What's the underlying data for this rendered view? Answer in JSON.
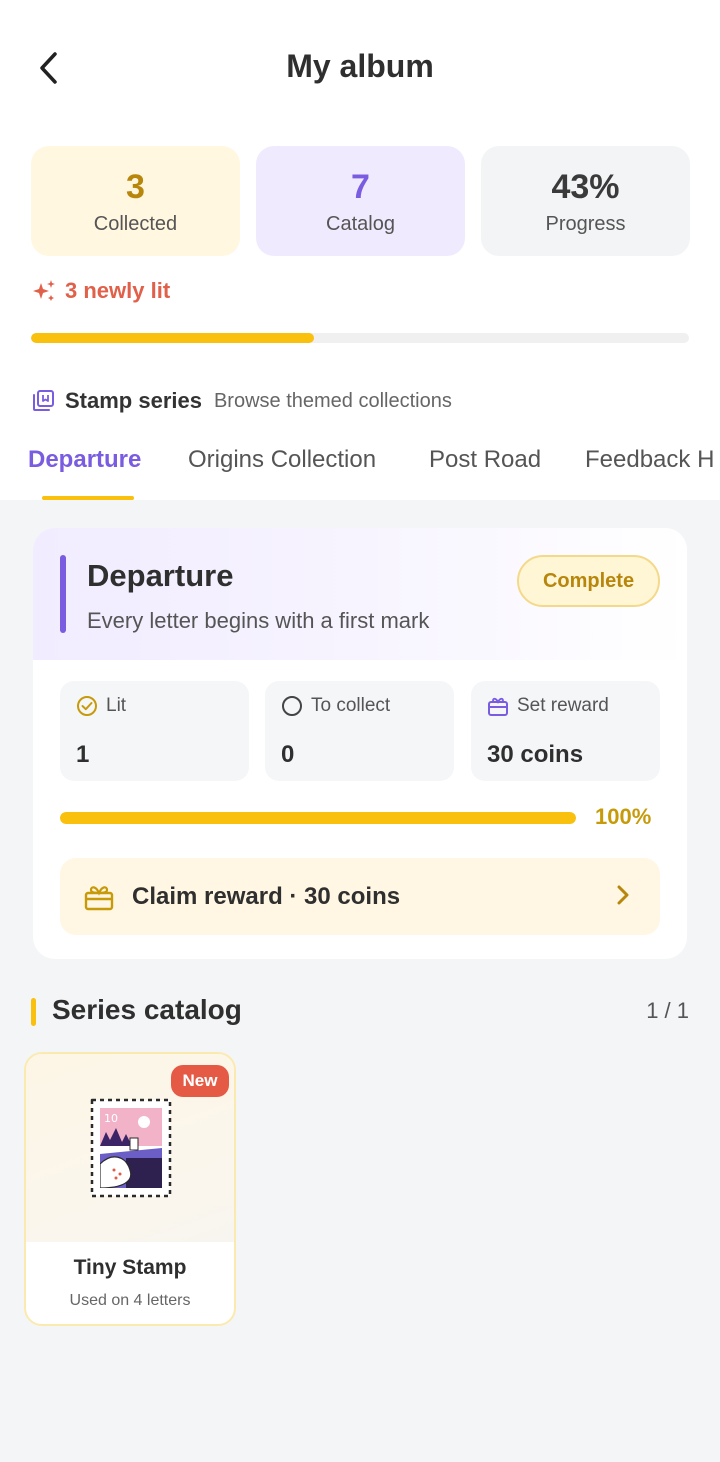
{
  "header": {
    "title": "My album"
  },
  "stats": {
    "collected": {
      "value": "3",
      "label": "Collected"
    },
    "catalog": {
      "value": "7",
      "label": "Catalog"
    },
    "progress": {
      "value": "43%",
      "label": "Progress"
    }
  },
  "newly_lit": {
    "text": "3 newly lit"
  },
  "overall_progress": {
    "fraction": 0.43
  },
  "series": {
    "title": "Stamp series",
    "subtitle": "Browse themed collections",
    "tabs": [
      {
        "label": "Departure",
        "active": true
      },
      {
        "label": "Origins Collection",
        "active": false
      },
      {
        "label": "Post Road",
        "active": false
      },
      {
        "label": "Feedback H",
        "active": false
      }
    ]
  },
  "detail": {
    "title": "Departure",
    "subtitle": "Every letter begins with a first mark",
    "badge": "Complete",
    "lit": {
      "label": "Lit",
      "value": "1"
    },
    "to_collect": {
      "label": "To collect",
      "value": "0"
    },
    "set_reward": {
      "label": "Set reward",
      "value": "30 coins"
    },
    "progress_fraction": 1.0,
    "progress_text": "100%",
    "claim_text": "Claim reward · 30 coins"
  },
  "catalog": {
    "title": "Series catalog",
    "page": "1 / 1",
    "items": [
      {
        "name": "Tiny Stamp",
        "meta": "Used on 4 letters",
        "badge": "New",
        "stamp_value": "10"
      }
    ]
  },
  "colors": {
    "accent_purple": "#7a5ce0",
    "accent_yellow": "#f9c00e",
    "gold_text": "#b8860b",
    "new_red": "#e55a45"
  },
  "icons": {
    "back": "chevron-left-icon",
    "sparkle": "sparkle-icon",
    "album": "album-icon",
    "check": "check-circle-icon",
    "circle": "circle-icon",
    "gift": "gift-icon",
    "chevron": "chevron-right-icon"
  }
}
